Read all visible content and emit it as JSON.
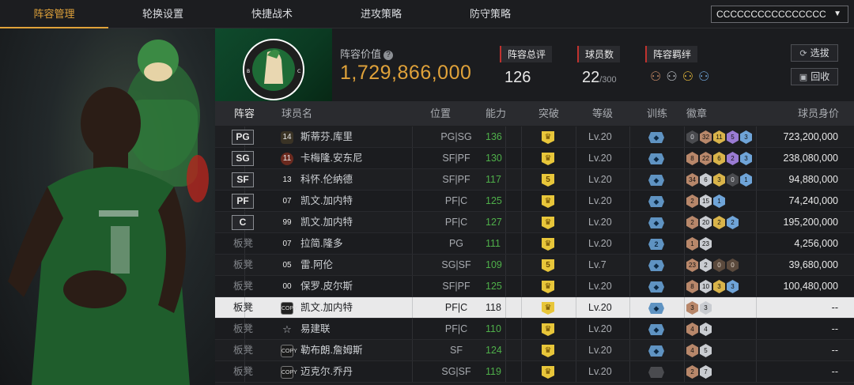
{
  "nav": {
    "tabs": [
      {
        "label": "阵容管理",
        "active": true
      },
      {
        "label": "轮换设置"
      },
      {
        "label": "快捷战术"
      },
      {
        "label": "进攻策略"
      },
      {
        "label": "防守策略"
      }
    ],
    "team_select": "CCCCCCCCCCCCCCCC"
  },
  "header": {
    "team_logo": "boston-celtics-logo",
    "value_label": "阵容价值",
    "value": "1,729,866,000",
    "overall_label": "阵容总评",
    "overall": "126",
    "count_label": "球员数",
    "count": "22",
    "count_max": "/300",
    "chemistry_label": "阵容羁绊",
    "btn_select": "选拔",
    "btn_recycle": "回收"
  },
  "table": {
    "columns": [
      "阵容",
      "球员名",
      "位置",
      "能力",
      "突破",
      "等级",
      "训练",
      "徽章",
      "球员身价"
    ],
    "rows": [
      {
        "role": "PG",
        "starter": true,
        "num": "14",
        "num_style": "hex",
        "name": "斯蒂芬.库里",
        "pos": "PG|SG",
        "ovr": "136",
        "break": "crown",
        "lv": "Lv.20",
        "train": "",
        "badges": [
          [
            "dark",
            "0"
          ],
          [
            "bronze",
            "32"
          ],
          [
            "gold",
            "11"
          ],
          [
            "purple",
            "5"
          ],
          [
            "blue",
            "3"
          ]
        ],
        "price": "723,200,000"
      },
      {
        "role": "SG",
        "starter": true,
        "num": "11",
        "num_style": "red",
        "name": "卡梅隆.安东尼",
        "pos": "SF|PF",
        "ovr": "130",
        "break": "crown",
        "lv": "Lv.20",
        "train": "",
        "badges": [
          [
            "bronze",
            "8"
          ],
          [
            "bronze",
            "22"
          ],
          [
            "gold",
            "6"
          ],
          [
            "purple",
            "2"
          ],
          [
            "blue",
            "3"
          ]
        ],
        "price": "238,080,000"
      },
      {
        "role": "SF",
        "starter": true,
        "num": "13",
        "num_style": "plain",
        "name": "科怀.伦纳德",
        "pos": "SF|PF",
        "ovr": "117",
        "break": "5",
        "lv": "Lv.20",
        "train": "",
        "badges": [
          [
            "bronze",
            "34"
          ],
          [
            "silver",
            "6"
          ],
          [
            "gold",
            "3"
          ],
          [
            "dark",
            "0"
          ],
          [
            "blue",
            "1"
          ]
        ],
        "price": "94,880,000"
      },
      {
        "role": "PF",
        "starter": true,
        "num": "07",
        "num_style": "plain",
        "name": "凯文.加内特",
        "pos": "PF|C",
        "ovr": "125",
        "break": "crown",
        "lv": "Lv.20",
        "train": "",
        "badges": [
          [
            "bronze",
            "2"
          ],
          [
            "silver",
            "15"
          ],
          [
            "blue",
            "1"
          ]
        ],
        "price": "74,240,000"
      },
      {
        "role": "C",
        "starter": true,
        "num": "99",
        "num_style": "plain",
        "name": "凯文.加内特",
        "pos": "PF|C",
        "ovr": "127",
        "break": "crown",
        "lv": "Lv.20",
        "train": "",
        "badges": [
          [
            "bronze",
            "2"
          ],
          [
            "silver",
            "20"
          ],
          [
            "gold",
            "2"
          ],
          [
            "blue",
            "2"
          ]
        ],
        "price": "195,200,000"
      },
      {
        "role": "板凳",
        "starter": false,
        "num": "07",
        "num_style": "plain",
        "name": "拉简.隆多",
        "pos": "PG",
        "ovr": "111",
        "break": "crown",
        "lv": "Lv.20",
        "train": "2",
        "badges": [
          [
            "bronze",
            "1"
          ],
          [
            "silver",
            "23"
          ]
        ],
        "price": "4,256,000"
      },
      {
        "role": "板凳",
        "starter": false,
        "num": "05",
        "num_style": "plain",
        "name": "雷.阿伦",
        "pos": "SG|SF",
        "ovr": "109",
        "break": "5",
        "lv": "Lv.7",
        "train": "",
        "badges": [
          [
            "bronze",
            "23"
          ],
          [
            "silver",
            "2"
          ],
          [
            "choco",
            "0"
          ],
          [
            "choco",
            "0"
          ]
        ],
        "price": "39,680,000"
      },
      {
        "role": "板凳",
        "starter": false,
        "num": "00",
        "num_style": "plain",
        "name": "保罗.皮尔斯",
        "pos": "SF|PF",
        "ovr": "125",
        "break": "crown",
        "lv": "Lv.20",
        "train": "",
        "badges": [
          [
            "bronze",
            "8"
          ],
          [
            "silver",
            "10"
          ],
          [
            "gold",
            "3"
          ],
          [
            "blue",
            "3"
          ]
        ],
        "price": "100,480,000"
      },
      {
        "role": "板凳",
        "starter": false,
        "num": "COPY",
        "num_style": "copy",
        "name": "凯文.加内特",
        "pos": "PF|C",
        "ovr": "118",
        "break": "crown",
        "lv": "Lv.20",
        "train": "",
        "badges": [
          [
            "bronze",
            "3"
          ],
          [
            "silver",
            "3"
          ]
        ],
        "price": "--",
        "selected": true
      },
      {
        "role": "板凳",
        "starter": false,
        "num": "☆",
        "num_style": "star",
        "name": "易建联",
        "pos": "PF|C",
        "ovr": "110",
        "break": "crown",
        "lv": "Lv.20",
        "train": "",
        "badges": [
          [
            "bronze",
            "4"
          ],
          [
            "silver",
            "4"
          ]
        ],
        "price": "--"
      },
      {
        "role": "板凳",
        "starter": false,
        "num": "COPY",
        "num_style": "copy",
        "name": "勒布朗.詹姆斯",
        "pos": "SF",
        "ovr": "124",
        "break": "crown",
        "lv": "Lv.20",
        "train": "",
        "badges": [
          [
            "bronze",
            "4"
          ],
          [
            "silver",
            "5"
          ]
        ],
        "price": "--"
      },
      {
        "role": "板凳",
        "starter": false,
        "num": "COPY",
        "num_style": "copy",
        "name": "迈克尔.乔丹",
        "pos": "SG|SF",
        "ovr": "119",
        "break": "crown",
        "lv": "Lv.20",
        "train": "grey",
        "badges": [
          [
            "bronze",
            "2"
          ],
          [
            "silver",
            "7"
          ]
        ],
        "price": "--"
      }
    ]
  }
}
